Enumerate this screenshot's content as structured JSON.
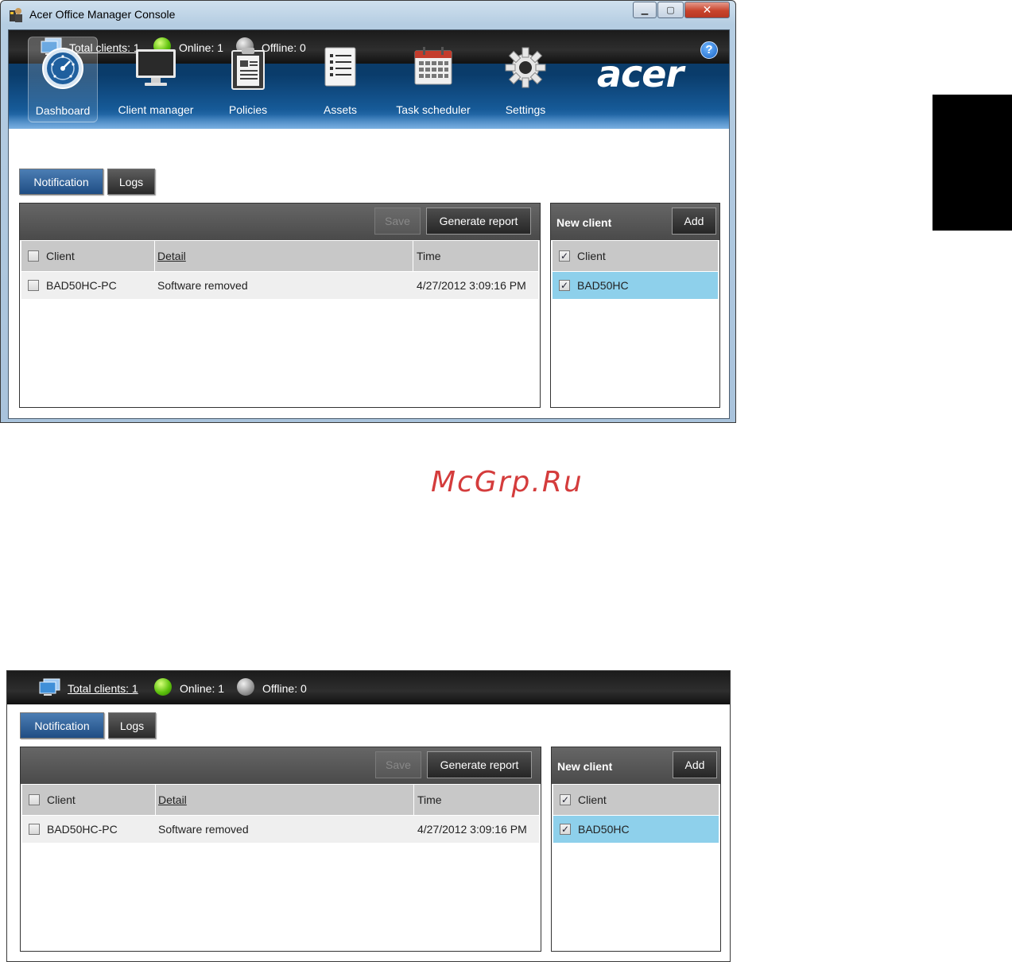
{
  "window": {
    "title": "Acer Office Manager Console",
    "minimize": "▁",
    "maximize": "▢",
    "close": "✕"
  },
  "nav": {
    "items": [
      {
        "label": "Dashboard",
        "icon": "dashboard-icon"
      },
      {
        "label": "Client manager",
        "icon": "monitor-icon"
      },
      {
        "label": "Policies",
        "icon": "policies-icon"
      },
      {
        "label": "Assets",
        "icon": "assets-icon"
      },
      {
        "label": "Task scheduler",
        "icon": "calendar-icon"
      },
      {
        "label": "Settings",
        "icon": "gear-icon"
      }
    ],
    "active": "Dashboard",
    "logo": "acer",
    "help": "?"
  },
  "status": {
    "total_clients": "Total clients: 1",
    "online": "Online: 1",
    "offline": "Offline: 0"
  },
  "tabs": {
    "notification": "Notification",
    "logs": "Logs",
    "active": "Notification"
  },
  "notifications": {
    "save_label": "Save",
    "generate_report_label": "Generate report",
    "columns": {
      "client": "Client",
      "detail": "Detail",
      "time": "Time"
    },
    "rows": [
      {
        "client": "BAD50HC-PC",
        "detail": "Software removed",
        "time": "4/27/2012 3:09:16 PM",
        "checked": false
      }
    ]
  },
  "new_client": {
    "title": "New client",
    "add_label": "Add",
    "column": "Client",
    "rows": [
      {
        "client": "BAD50HC",
        "checked": true
      }
    ]
  },
  "watermark": "McGrp.Ru",
  "colors": {
    "ribbon": "#0a3c6b",
    "selection": "#8ed0eb",
    "online": "#5fc20e",
    "offline": "#9a9a9a",
    "active_tab": "#2f5f96",
    "watermark": "#d43c3c"
  }
}
